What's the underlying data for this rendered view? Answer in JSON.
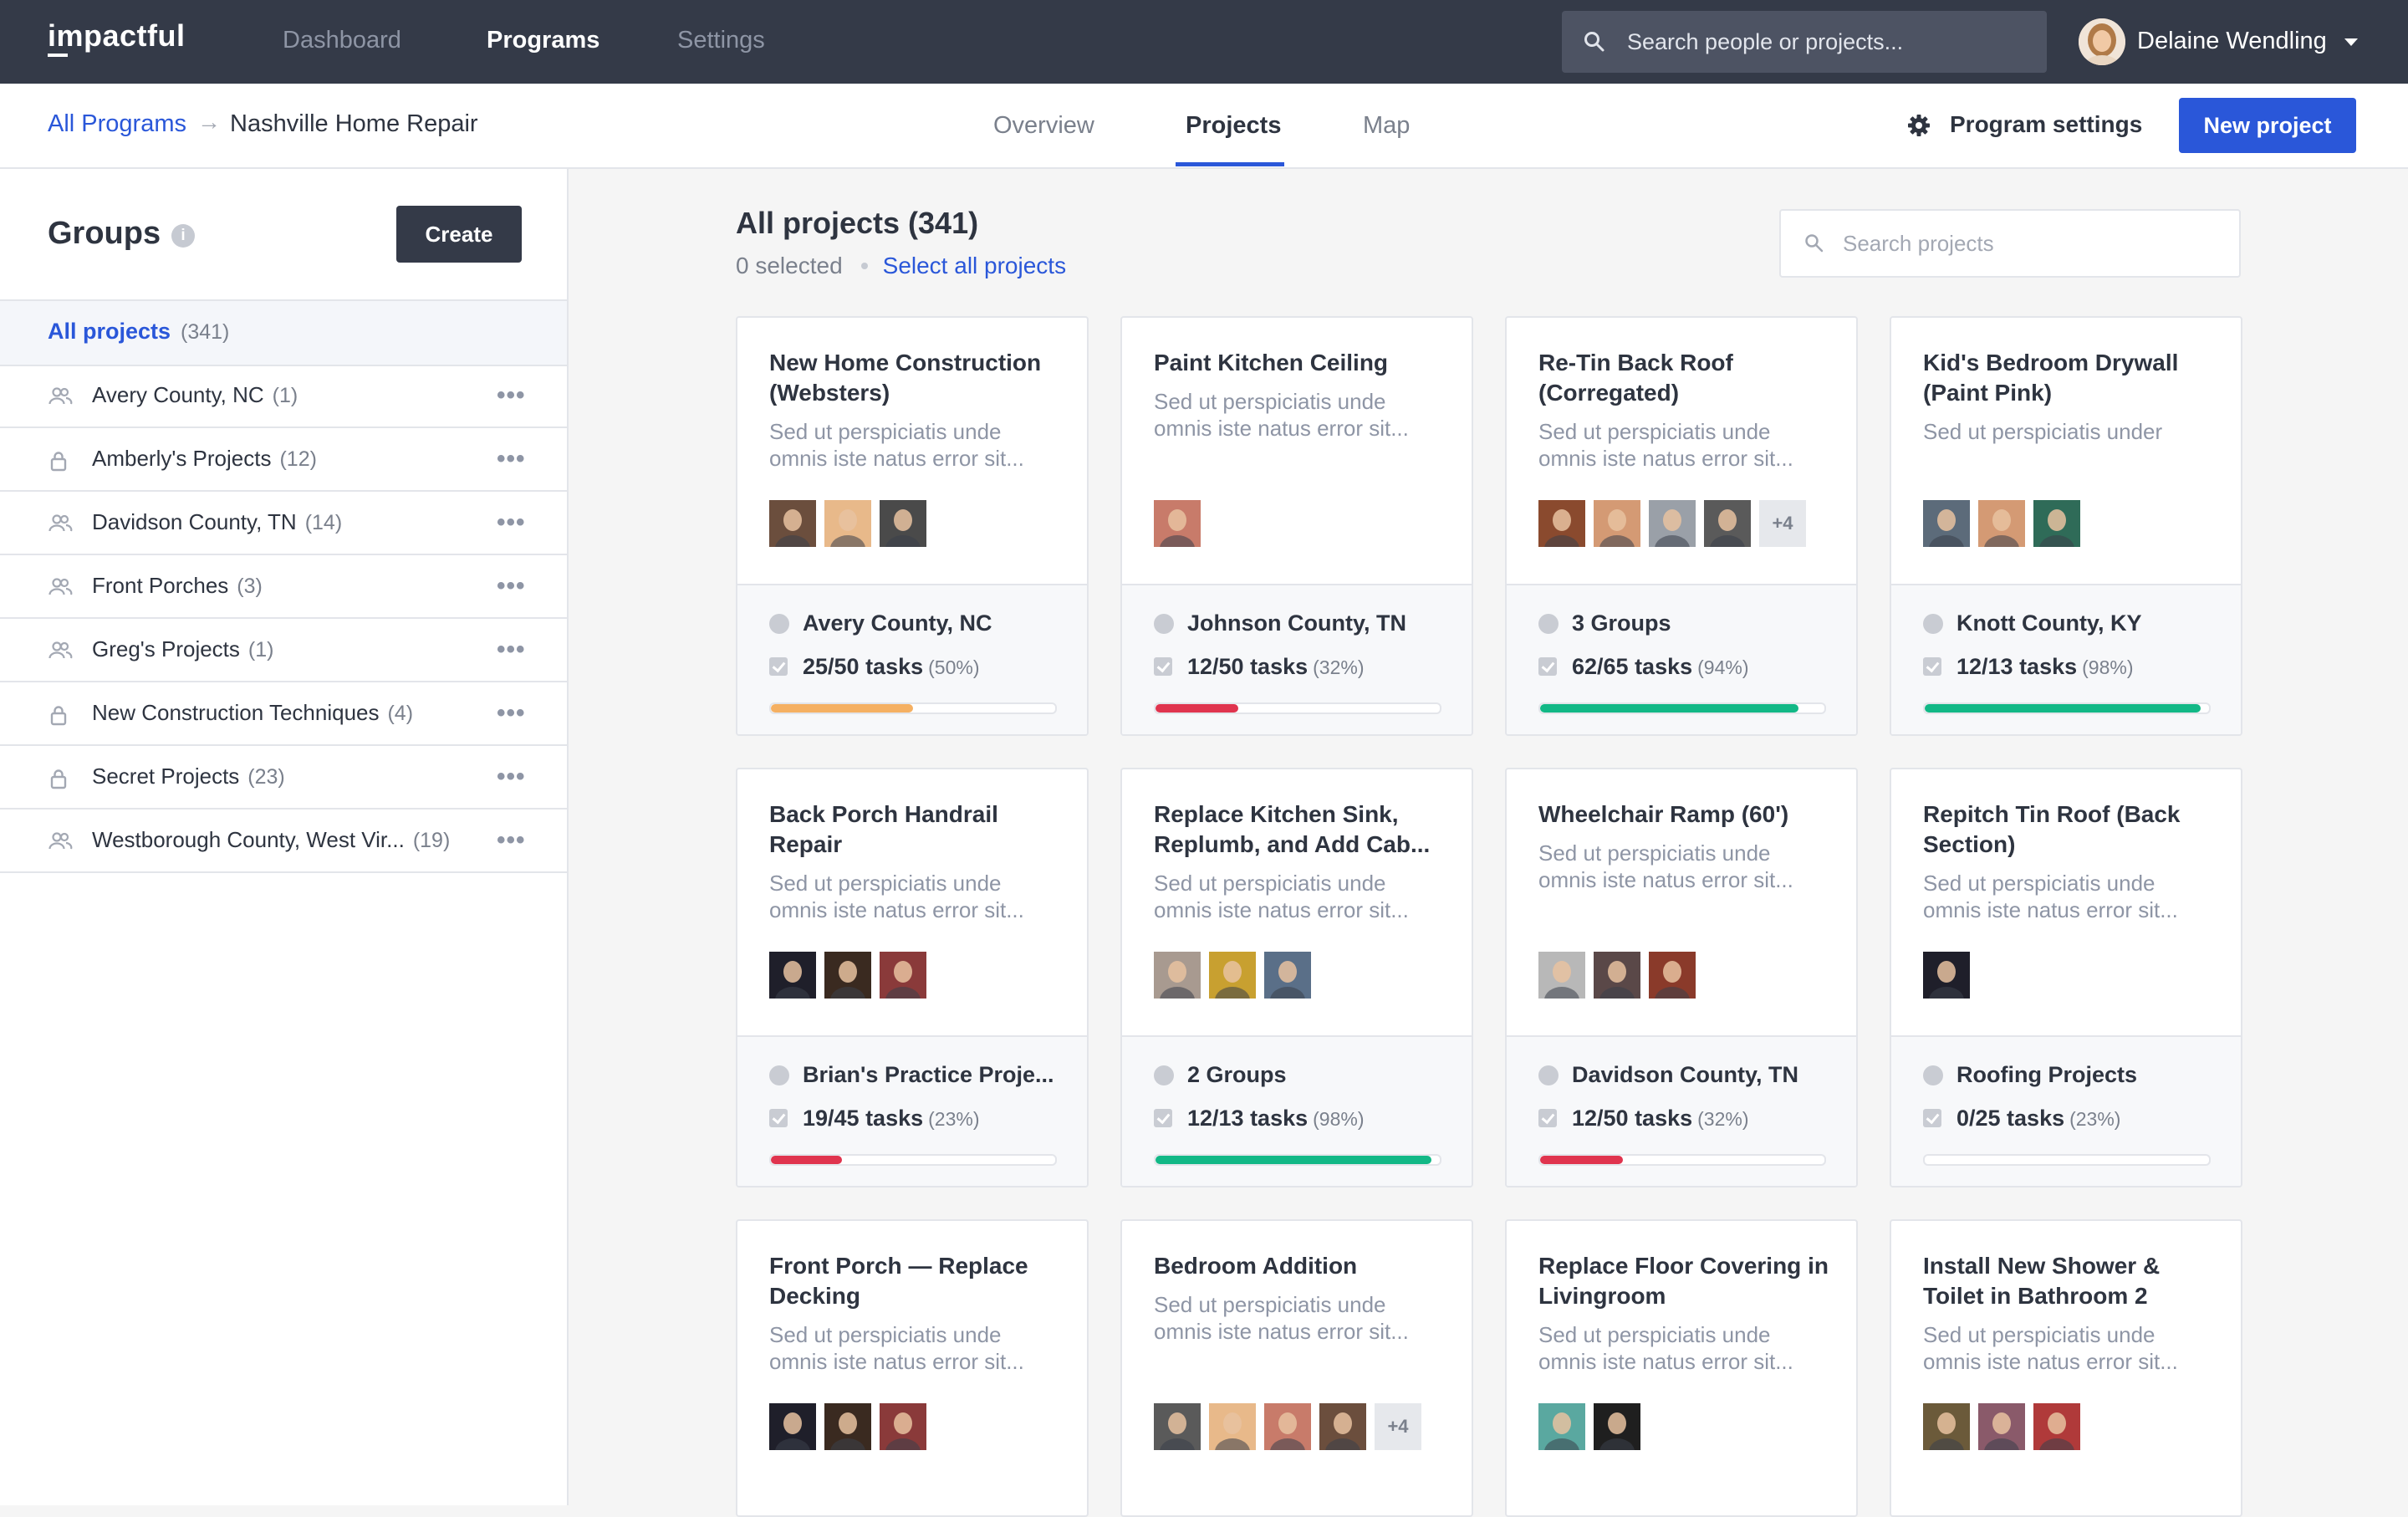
{
  "brand": {
    "logo_text": "impactful"
  },
  "topnav": {
    "items": [
      {
        "label": "Dashboard"
      },
      {
        "label": "Programs"
      },
      {
        "label": "Settings"
      }
    ],
    "search_placeholder": "Search people or projects...",
    "user_name": "Delaine Wendling"
  },
  "subheader": {
    "breadcrumb_root": "All Programs",
    "breadcrumb_current": "Nashville Home Repair",
    "tabs": [
      {
        "label": "Overview"
      },
      {
        "label": "Projects"
      },
      {
        "label": "Map"
      }
    ],
    "active_tab": "Projects",
    "program_settings_label": "Program settings",
    "new_project_label": "New project"
  },
  "sidebar": {
    "title": "Groups",
    "create_label": "Create",
    "all_projects": {
      "label": "All projects",
      "count": "(341)"
    },
    "groups": [
      {
        "name": "Avery County, NC",
        "count": "(1)",
        "icon": "people-icon"
      },
      {
        "name": "Amberly's Projects",
        "count": "(12)",
        "icon": "lock-icon"
      },
      {
        "name": "Davidson County, TN",
        "count": "(14)",
        "icon": "people-icon"
      },
      {
        "name": "Front Porches",
        "count": "(3)",
        "icon": "people-icon"
      },
      {
        "name": "Greg's Projects",
        "count": "(1)",
        "icon": "people-icon"
      },
      {
        "name": "New Construction Techniques",
        "count": "(4)",
        "icon": "lock-icon"
      },
      {
        "name": "Secret Projects",
        "count": "(23)",
        "icon": "lock-icon"
      },
      {
        "name": "Westborough County, West Vir...",
        "count": "(19)",
        "icon": "people-icon"
      }
    ],
    "more_glyph": "•••"
  },
  "main": {
    "title": "All projects (341)",
    "selected_text": "0 selected",
    "select_all_label": "Select all projects",
    "search_placeholder": "Search projects"
  },
  "colors": {
    "accent": "#2a57d9",
    "orange": "#f5b062",
    "red": "#e0344e",
    "green": "#12b886",
    "nav_bg": "#343a48"
  },
  "projects": [
    {
      "title": "New Home Construction (Websters)",
      "desc": "Sed ut perspiciatis unde omnis iste natus error sit...",
      "avatars": [
        "#6b4e3d",
        "#e8b98a",
        "#4a4a4a"
      ],
      "extra": "",
      "group": "Avery County, NC",
      "tasks": "25/50 tasks",
      "pct": "(50%)",
      "progress": 0.5,
      "bar_color": "#f5b062"
    },
    {
      "title": "Paint Kitchen Ceiling",
      "desc": "Sed ut perspiciatis unde omnis iste natus error sit...",
      "avatars": [
        "#c87b6a"
      ],
      "extra": "",
      "group": "Johnson County, TN",
      "tasks": "12/50 tasks",
      "pct": "(32%)",
      "progress": 0.29,
      "bar_color": "#e0344e"
    },
    {
      "title": "Re-Tin Back Roof (Corregated)",
      "desc": "Sed ut perspiciatis unde omnis iste natus error sit...",
      "avatars": [
        "#8a4a2e",
        "#d49a74",
        "#9aa0a8",
        "#5a5a5a"
      ],
      "extra": "+4",
      "group": "3 Groups",
      "tasks": "62/65 tasks",
      "pct": "(94%)",
      "progress": 0.91,
      "bar_color": "#12b886"
    },
    {
      "title": "Kid's Bedroom Drywall (Paint Pink)",
      "desc": "Sed ut perspiciatis under",
      "avatars": [
        "#5c6b7a",
        "#d49a74",
        "#2f6b58"
      ],
      "extra": "",
      "group": "Knott County, KY",
      "tasks": "12/13 tasks",
      "pct": "(98%)",
      "progress": 0.97,
      "bar_color": "#12b886"
    },
    {
      "title": "Back Porch Handrail Repair",
      "desc": "Sed ut perspiciatis unde omnis iste natus error sit...",
      "avatars": [
        "#1f1f2a",
        "#3a2a20",
        "#8a3a3a"
      ],
      "extra": "",
      "group": "Brian's Practice Proje...",
      "tasks": "19/45 tasks",
      "pct": "(23%)",
      "progress": 0.25,
      "bar_color": "#e0344e"
    },
    {
      "title": "Replace Kitchen Sink, Replumb, and Add Cab...",
      "desc": "Sed ut perspiciatis unde omnis iste natus error sit...",
      "avatars": [
        "#a89a90",
        "#c8a030",
        "#5a6f88"
      ],
      "extra": "",
      "group": "2 Groups",
      "tasks": "12/13 tasks",
      "pct": "(98%)",
      "progress": 0.97,
      "bar_color": "#12b886"
    },
    {
      "title": "Wheelchair Ramp (60')",
      "desc": "Sed ut perspiciatis unde omnis iste natus error sit...",
      "avatars": [
        "#b8b8b8",
        "#5a4848",
        "#8a3a2a"
      ],
      "extra": "",
      "group": "Davidson County, TN",
      "tasks": "12/50 tasks",
      "pct": "(32%)",
      "progress": 0.29,
      "bar_color": "#e0344e"
    },
    {
      "title": "Repitch Tin Roof (Back Section)",
      "desc": "Sed ut perspiciatis unde omnis iste natus error sit...",
      "avatars": [
        "#1f1f2a"
      ],
      "extra": "",
      "group": "Roofing Projects",
      "tasks": "0/25 tasks",
      "pct": "(23%)",
      "progress": 0.0,
      "bar_color": "#e0344e"
    },
    {
      "title": "Front Porch — Replace Decking",
      "desc": "Sed ut perspiciatis unde omnis iste natus error sit...",
      "avatars": [
        "#1f1f2a",
        "#3a2a20",
        "#8a3a3a"
      ],
      "extra": "",
      "group": "",
      "tasks": "",
      "pct": "",
      "progress": 0.0,
      "bar_color": "#e0344e"
    },
    {
      "title": "Bedroom Addition",
      "desc": "Sed ut perspiciatis unde omnis iste natus error sit...",
      "avatars": [
        "#5a5a5a",
        "#e8b98a",
        "#c87b6a",
        "#6b4e3d"
      ],
      "extra": "+4",
      "group": "",
      "tasks": "",
      "pct": "",
      "progress": 0.0,
      "bar_color": "#e0344e"
    },
    {
      "title": "Replace Floor Covering in Livingroom",
      "desc": "Sed ut perspiciatis unde omnis iste natus error sit...",
      "avatars": [
        "#5aa8a0",
        "#1f1f1f"
      ],
      "extra": "",
      "group": "",
      "tasks": "",
      "pct": "",
      "progress": 0.0,
      "bar_color": "#e0344e"
    },
    {
      "title": "Install New Shower & Toilet in Bathroom 2",
      "desc": "Sed ut perspiciatis unde omnis iste natus error sit...",
      "avatars": [
        "#6b5a3a",
        "#8a5a6a",
        "#b03a3a"
      ],
      "extra": "",
      "group": "",
      "tasks": "",
      "pct": "",
      "progress": 0.0,
      "bar_color": "#e0344e"
    }
  ]
}
